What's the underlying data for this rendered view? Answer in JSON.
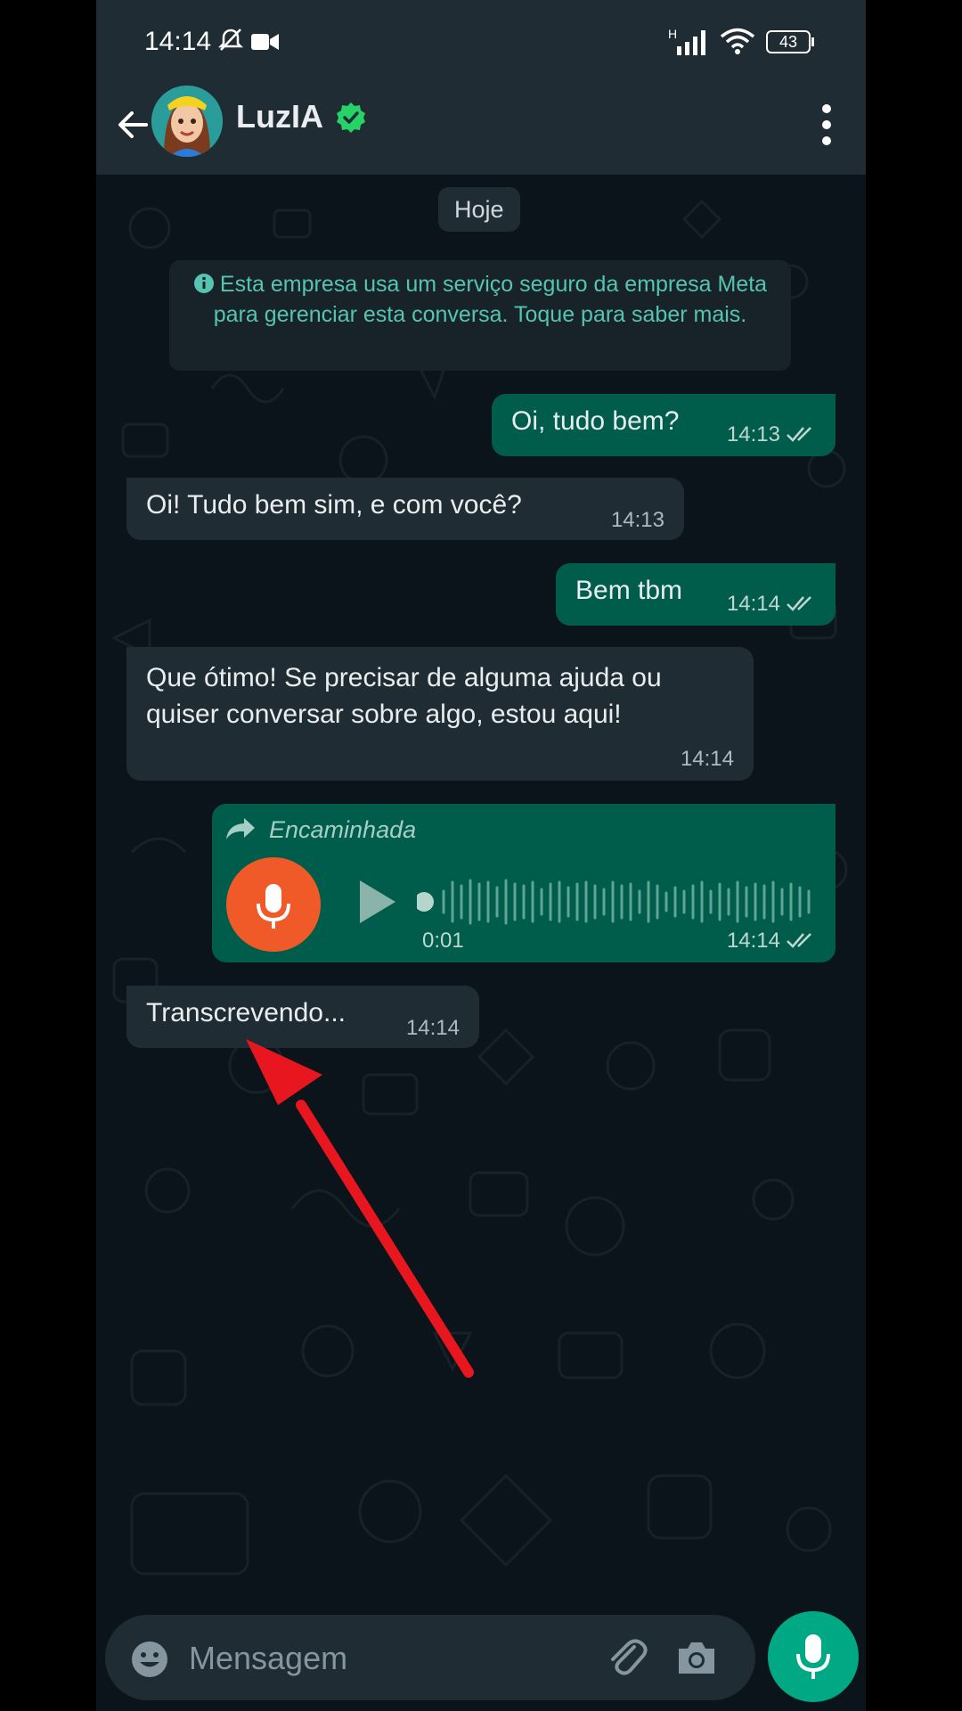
{
  "status_bar": {
    "time": "14:14",
    "battery": "43",
    "network": "H"
  },
  "header": {
    "title": "LuzIA"
  },
  "chat": {
    "day_label": "Hoje",
    "system_note": "Esta empresa usa um serviço seguro da empresa Meta para gerenciar esta conversa. Toque para saber mais.",
    "messages": [
      {
        "direction": "out",
        "text": "Oi, tudo bem?",
        "time": "14:13",
        "status": "read"
      },
      {
        "direction": "in",
        "text": "Oi! Tudo bem sim, e com você?",
        "time": "14:13"
      },
      {
        "direction": "out",
        "text": "Bem tbm",
        "time": "14:14",
        "status": "read"
      },
      {
        "direction": "in",
        "text": "Que ótimo! Se precisar de alguma ajuda ou quiser conversar sobre algo, estou aqui!",
        "time": "14:14"
      },
      {
        "direction": "out",
        "type": "audio",
        "forwarded_label": "Encaminhada",
        "duration": "0:01",
        "time": "14:14",
        "status": "read"
      },
      {
        "direction": "in",
        "text": "Transcrevendo...",
        "time": "14:14"
      }
    ]
  },
  "input": {
    "placeholder": "Mensagem"
  },
  "colors": {
    "accent": "#00a884",
    "outgoing": "#005c4b",
    "incoming": "#202c33",
    "audio_mic": "#f05a28",
    "annotation_arrow": "#e8171f"
  },
  "icons": [
    "back-arrow-icon",
    "verified-badge-icon",
    "more-vert-icon",
    "info-icon",
    "forward-icon",
    "mic-icon",
    "play-icon",
    "double-check-icon",
    "emoji-icon",
    "attach-icon",
    "camera-icon"
  ]
}
